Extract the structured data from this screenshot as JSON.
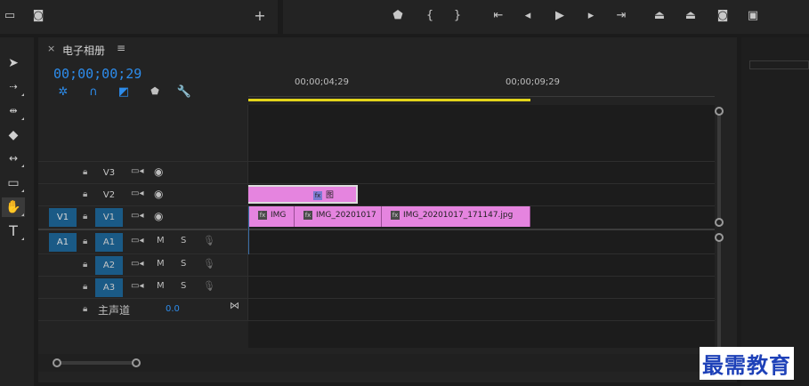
{
  "panel": {
    "close_glyph": "×",
    "title": "电子相册",
    "menu_glyph": "≡"
  },
  "timecode": "00;00;00;29",
  "ruler": {
    "labels": [
      "00;00;04;29",
      "00;00;09;29"
    ]
  },
  "tracks": {
    "video": [
      {
        "source": "",
        "label": "V3",
        "label_active": false
      },
      {
        "source": "",
        "label": "V2",
        "label_active": false
      },
      {
        "source": "V1",
        "label": "V1",
        "label_active": true
      }
    ],
    "audio": [
      {
        "source": "A1",
        "label": "A1",
        "m": "M",
        "s": "S"
      },
      {
        "source": "",
        "label": "A2",
        "m": "M",
        "s": "S"
      },
      {
        "source": "",
        "label": "A3",
        "m": "M",
        "s": "S"
      }
    ],
    "master": {
      "label": "主声道",
      "value": "0.0"
    }
  },
  "clips": {
    "v2": {
      "fx": "fx",
      "label": "图"
    },
    "v1": [
      {
        "fx": "fx",
        "label": "IMG"
      },
      {
        "fx": "fx",
        "label": "IMG_20201017"
      },
      {
        "fx": "fx",
        "label": "IMG_20201017_171147.jpg"
      }
    ]
  },
  "icons": {
    "top_left": [
      "export-frame-icon",
      "camera-icon",
      "plus-icon"
    ],
    "transport": [
      "marker-icon",
      "mark-in-icon",
      "mark-out-icon",
      "go-to-in-icon",
      "step-back-icon",
      "play-icon",
      "step-forward-icon",
      "go-to-out-icon",
      "lift-icon",
      "extract-icon",
      "export-frame-icon",
      "comparison-view-icon"
    ],
    "tools": [
      "selection-tool-icon",
      "track-select-tool-icon",
      "ripple-edit-tool-icon",
      "razor-tool-icon",
      "slip-tool-icon",
      "rectangle-tool-icon",
      "hand-tool-icon",
      "type-tool-icon"
    ]
  },
  "colors": {
    "timecode": "#2d8ceb",
    "track_target": "#1a5a86",
    "clip": "#e584df",
    "work_area": "#e2d41a"
  },
  "watermark": "最需教育"
}
